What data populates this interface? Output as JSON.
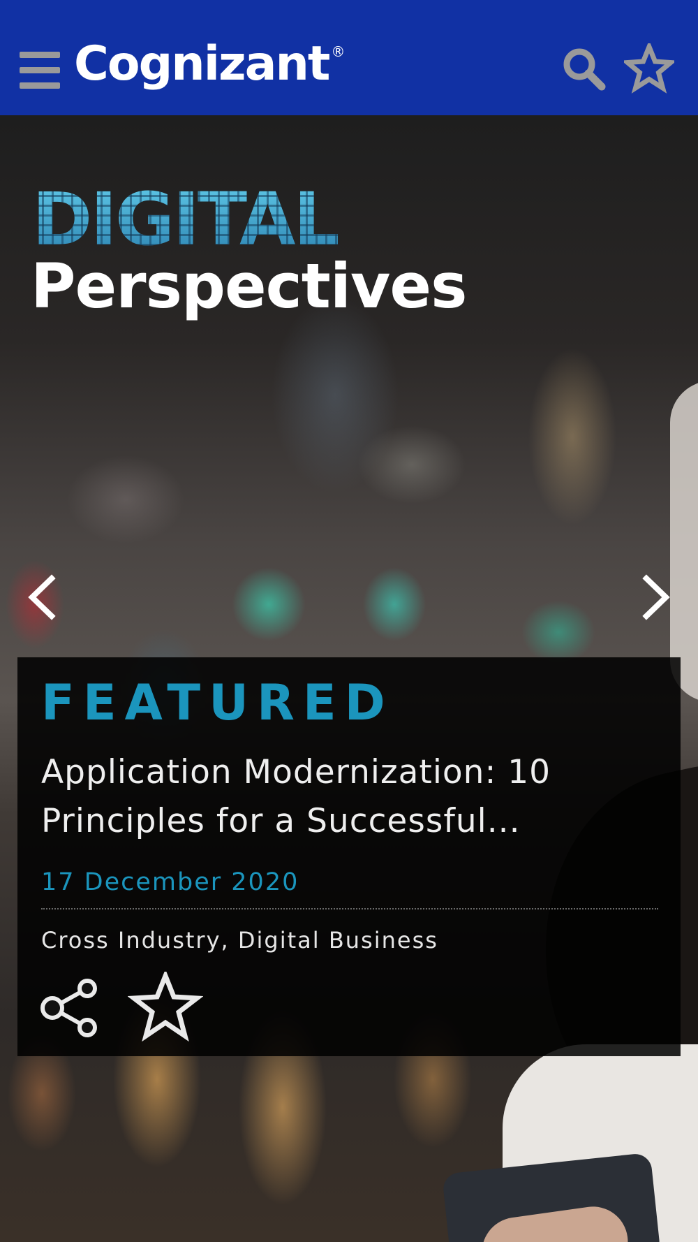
{
  "header": {
    "brand": "Cognizant",
    "brand_mark": "®",
    "menu_icon": "hamburger-menu-icon",
    "search_icon": "search-icon",
    "favorites_icon": "star-icon",
    "background_color": "#1131a4"
  },
  "hero": {
    "title_line1": "DIGITAL",
    "title_line2": "Perspectives",
    "prev_icon": "chevron-left-icon",
    "next_icon": "chevron-right-icon"
  },
  "featured": {
    "label": "FEATURED",
    "title": "Application Modernization: 10 Principles for a Successful...",
    "date": "17 December 2020",
    "tags": "Cross Industry, Digital Business",
    "share_icon": "share-icon",
    "bookmark_icon": "star-icon",
    "accent_color": "#1b95bd"
  }
}
